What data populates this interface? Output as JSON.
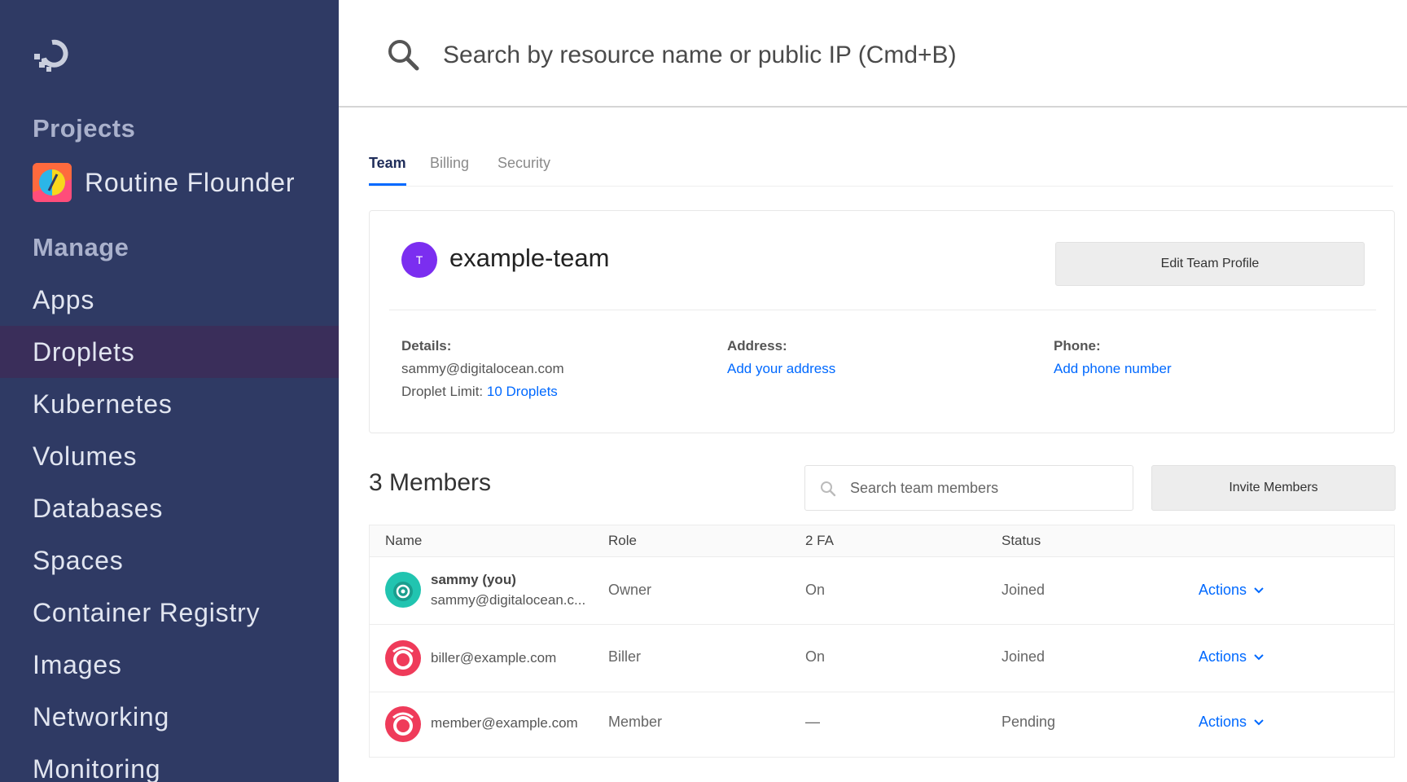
{
  "sidebar": {
    "projects_heading": "Projects",
    "project_name": "Routine Flounder",
    "manage_heading": "Manage",
    "items": [
      {
        "label": "Apps"
      },
      {
        "label": "Droplets"
      },
      {
        "label": "Kubernetes"
      },
      {
        "label": "Volumes"
      },
      {
        "label": "Databases"
      },
      {
        "label": "Spaces"
      },
      {
        "label": "Container Registry"
      },
      {
        "label": "Images"
      },
      {
        "label": "Networking"
      },
      {
        "label": "Monitoring"
      }
    ],
    "active_item": "Droplets",
    "colors": {
      "background": "#2f3a64",
      "active": "#3a2e5a",
      "heading": "#aab1cc"
    }
  },
  "search": {
    "placeholder": "Search by resource name or public IP (Cmd+B)",
    "icon": "search-icon"
  },
  "tabs": [
    {
      "label": "Team",
      "active": true
    },
    {
      "label": "Billing",
      "active": false
    },
    {
      "label": "Security",
      "active": false
    }
  ],
  "team": {
    "avatar_letter": "T",
    "name": "example-team",
    "edit_label": "Edit Team Profile",
    "details_label": "Details:",
    "email": "sammy@digitalocean.com",
    "droplet_limit_label": "Droplet Limit:",
    "droplet_limit_value": "10 Droplets",
    "address_label": "Address:",
    "address_link": "Add your address",
    "phone_label": "Phone:",
    "phone_link": "Add phone number",
    "avatar_color": "#7b2ef0"
  },
  "members": {
    "title": "3 Members",
    "search_placeholder": "Search team members",
    "invite_label": "Invite Members",
    "columns": [
      "Name",
      "Role",
      "2 FA",
      "Status"
    ],
    "rows": [
      {
        "name": "sammy (you)",
        "email": "sammy@digitalocean.c...",
        "role": "Owner",
        "twofa": "On",
        "status": "Joined",
        "action": "Actions"
      },
      {
        "name": "",
        "email": "biller@example.com",
        "role": "Biller",
        "twofa": "On",
        "status": "Joined",
        "action": "Actions"
      },
      {
        "name": "",
        "email": "member@example.com",
        "role": "Member",
        "twofa": "—",
        "status": "Pending",
        "action": "Actions"
      }
    ]
  },
  "accent_color": "#0069ff"
}
